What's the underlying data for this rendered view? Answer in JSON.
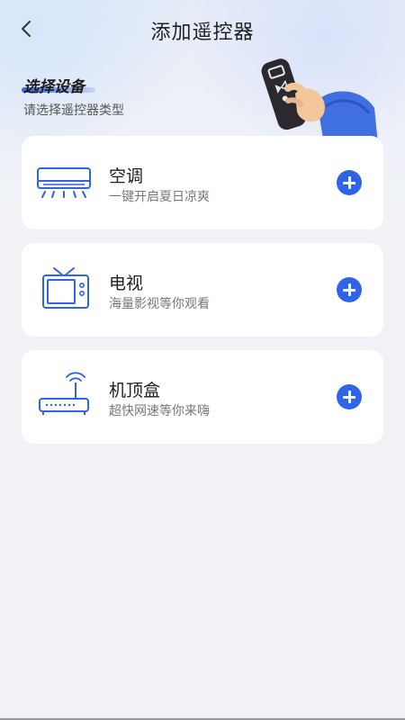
{
  "header": {
    "title": "添加遥控器",
    "back_icon": "chevron-left-icon"
  },
  "section": {
    "title": "选择设备",
    "subtitle": "请选择遥控器类型"
  },
  "devices": [
    {
      "name": "空调",
      "desc": "一键开启夏日凉爽",
      "icon": "air-conditioner-icon"
    },
    {
      "name": "电视",
      "desc": "海量影视等你观看",
      "icon": "tv-icon"
    },
    {
      "name": "机顶盒",
      "desc": "超快网速等你来嗨",
      "icon": "router-icon"
    }
  ],
  "colors": {
    "accent": "#2f64e9",
    "background": "#f1f2f6",
    "card": "#ffffff"
  }
}
